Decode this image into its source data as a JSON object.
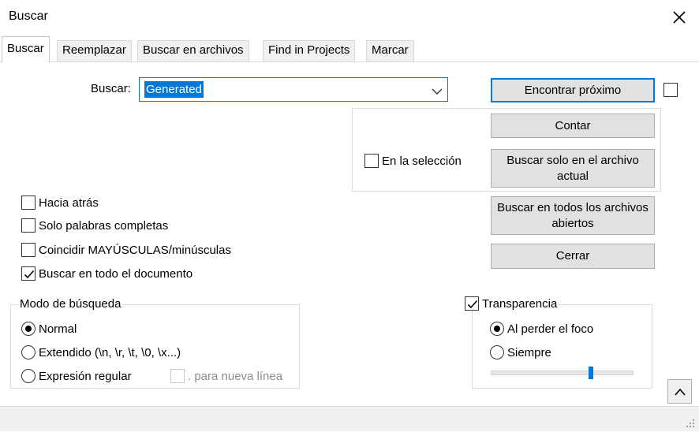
{
  "window": {
    "title": "Buscar"
  },
  "tabs": [
    {
      "label": "Buscar",
      "active": true
    },
    {
      "label": "Reemplazar"
    },
    {
      "label": "Buscar en archivos"
    },
    {
      "label": "Find in Projects"
    },
    {
      "label": "Marcar"
    }
  ],
  "search": {
    "label": "Buscar:",
    "value": "Generated"
  },
  "buttons": {
    "find_next": "Encontrar próximo",
    "count": "Contar",
    "find_in_current": "Buscar solo en el archivo actual",
    "find_in_all_open": "Buscar en todos los archivos abiertos",
    "close": "Cerrar"
  },
  "in_selection": {
    "label": "En la selección",
    "checked": false
  },
  "options": {
    "backward": {
      "label": "Hacia atrás",
      "checked": false
    },
    "whole_word": {
      "label": "Solo palabras completas",
      "checked": false
    },
    "match_case": {
      "label": "Coincidir MAYÚSCULAS/minúsculas",
      "checked": false
    },
    "wrap_around": {
      "label": "Buscar en todo el documento",
      "checked": true
    }
  },
  "search_mode": {
    "legend": "Modo de búsqueda",
    "normal": "Normal",
    "extended": "Extendido (\\n, \\r, \\t, \\0, \\x...)",
    "regex": "Expresión regular",
    "dot_newline": ". para nueva línea",
    "selected": "normal"
  },
  "transparency": {
    "label": "Transparencia",
    "enabled": true,
    "on_lose_focus": "Al perder el foco",
    "always": "Siempre",
    "selected": "on_lose_focus",
    "level_fraction": 0.7
  },
  "colors": {
    "accent": "#0078d7",
    "button_bg": "#e1e1e1"
  }
}
